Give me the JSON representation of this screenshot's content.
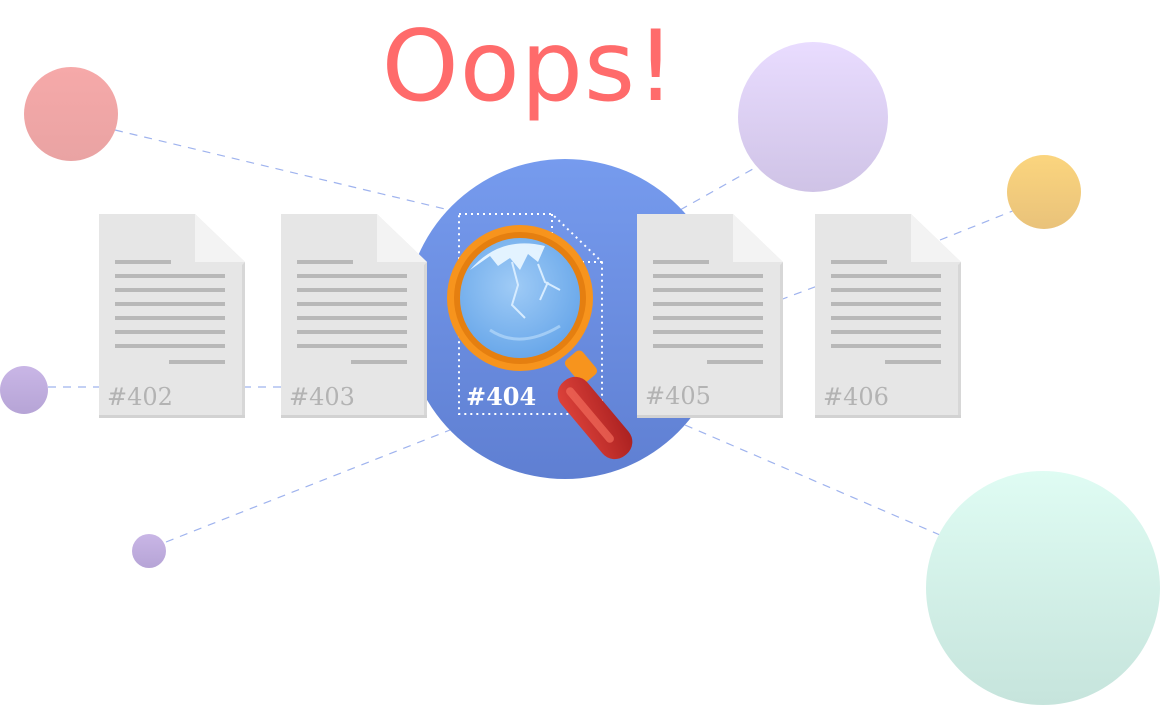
{
  "headline": "Oops!",
  "documents": [
    {
      "label": "#402",
      "state": "inactive"
    },
    {
      "label": "#403",
      "state": "inactive"
    },
    {
      "label": "#404",
      "state": "active"
    },
    {
      "label": "#405",
      "state": "inactive"
    },
    {
      "label": "#406",
      "state": "inactive"
    }
  ],
  "colors": {
    "headline": "#ff6b6b",
    "center_circle": "#6b8fe3",
    "document_fill": "#e6e6e6",
    "document_lines": "#b8b8b8",
    "magnifier_ring": "#f7941d",
    "magnifier_lens": "#7fb6ee",
    "magnifier_handle": "#c62828",
    "dashed_line": "#9fb3ee"
  },
  "decor": {
    "orbs": [
      "red-orb",
      "lavender-orb",
      "yellow-orb",
      "purple-orb-left",
      "purple-orb-small",
      "mint-orb"
    ],
    "icons": [
      "magnifying-glass-icon",
      "document-icon"
    ]
  }
}
